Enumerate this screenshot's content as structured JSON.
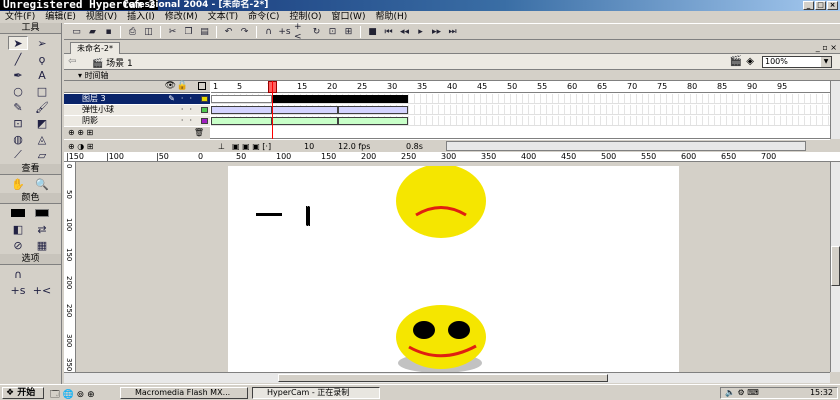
{
  "window": {
    "hypercam_label": "Unregistered HyperCam 2",
    "title_rest": "rofessional 2004 - [未命名-2*]"
  },
  "menu": [
    "文件(F)",
    "编辑(E)",
    "视图(V)",
    "插入(I)",
    "修改(M)",
    "文本(T)",
    "命令(C)",
    "控制(O)",
    "窗口(W)",
    "帮助(H)"
  ],
  "tools": {
    "title": "工具",
    "view_title": "查看",
    "colors_title": "颜色",
    "options_title": "选项"
  },
  "document": {
    "tab_label": "未命名-2*",
    "scene_label": "场景 1",
    "zoom_value": "100%"
  },
  "timeline": {
    "header_label": "时间轴",
    "ruler_numbers": [
      "1",
      "5",
      "10",
      "15",
      "20",
      "25",
      "30",
      "35",
      "40",
      "45",
      "50",
      "55",
      "60",
      "65",
      "70",
      "75",
      "80",
      "85",
      "90",
      "95"
    ],
    "layers": [
      {
        "name": "图层 3",
        "selected": true,
        "color": "#e6d800"
      },
      {
        "name": "弹性小球",
        "selected": false,
        "color": "#50c850"
      },
      {
        "name": "阴影",
        "selected": false,
        "color": "#a020c0"
      }
    ],
    "current_frame": "10",
    "fps": "12.0 fps",
    "time": "0.8s"
  },
  "stage_ruler": [
    "0",
    "50",
    "100",
    "150",
    "200",
    "250",
    "300",
    "350",
    "400",
    "450",
    "500",
    "550",
    "600",
    "650",
    "700"
  ],
  "stage_ruler_left": [
    "|150",
    "|100",
    "|50"
  ],
  "vruler_labels": [
    "0",
    "50",
    "100",
    "150",
    "200",
    "250",
    "300",
    "350"
  ],
  "taskbar": {
    "start_label": "开始",
    "item1": "Macromedia Flash MX...",
    "item2": "HyperCam - 正在录制",
    "clock": "15:32"
  },
  "colors": {
    "smiley_yellow": "#f5e600",
    "mouth_red": "#e02010",
    "stroke_color": "#000000",
    "fill_color": "#000000"
  }
}
